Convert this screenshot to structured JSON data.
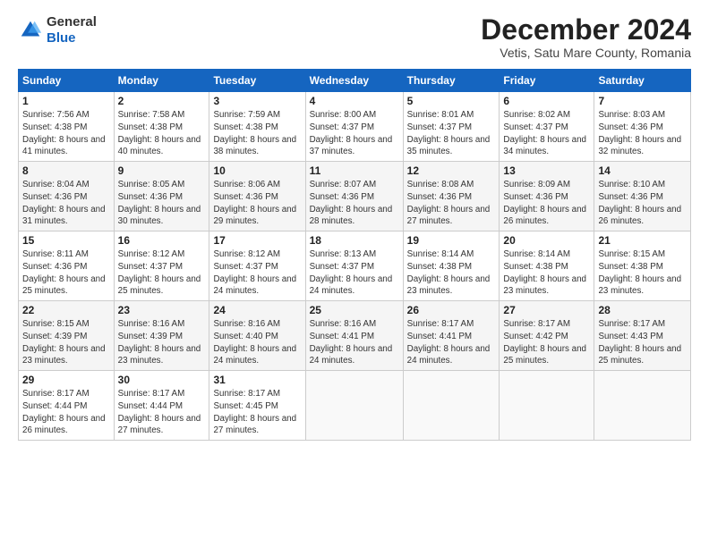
{
  "header": {
    "logo_general": "General",
    "logo_blue": "Blue",
    "month_title": "December 2024",
    "subtitle": "Vetis, Satu Mare County, Romania"
  },
  "days_of_week": [
    "Sunday",
    "Monday",
    "Tuesday",
    "Wednesday",
    "Thursday",
    "Friday",
    "Saturday"
  ],
  "weeks": [
    [
      {
        "num": "1",
        "sunrise": "7:56 AM",
        "sunset": "4:38 PM",
        "daylight": "8 hours and 41 minutes."
      },
      {
        "num": "2",
        "sunrise": "7:58 AM",
        "sunset": "4:38 PM",
        "daylight": "8 hours and 40 minutes."
      },
      {
        "num": "3",
        "sunrise": "7:59 AM",
        "sunset": "4:38 PM",
        "daylight": "8 hours and 38 minutes."
      },
      {
        "num": "4",
        "sunrise": "8:00 AM",
        "sunset": "4:37 PM",
        "daylight": "8 hours and 37 minutes."
      },
      {
        "num": "5",
        "sunrise": "8:01 AM",
        "sunset": "4:37 PM",
        "daylight": "8 hours and 35 minutes."
      },
      {
        "num": "6",
        "sunrise": "8:02 AM",
        "sunset": "4:37 PM",
        "daylight": "8 hours and 34 minutes."
      },
      {
        "num": "7",
        "sunrise": "8:03 AM",
        "sunset": "4:36 PM",
        "daylight": "8 hours and 32 minutes."
      }
    ],
    [
      {
        "num": "8",
        "sunrise": "8:04 AM",
        "sunset": "4:36 PM",
        "daylight": "8 hours and 31 minutes."
      },
      {
        "num": "9",
        "sunrise": "8:05 AM",
        "sunset": "4:36 PM",
        "daylight": "8 hours and 30 minutes."
      },
      {
        "num": "10",
        "sunrise": "8:06 AM",
        "sunset": "4:36 PM",
        "daylight": "8 hours and 29 minutes."
      },
      {
        "num": "11",
        "sunrise": "8:07 AM",
        "sunset": "4:36 PM",
        "daylight": "8 hours and 28 minutes."
      },
      {
        "num": "12",
        "sunrise": "8:08 AM",
        "sunset": "4:36 PM",
        "daylight": "8 hours and 27 minutes."
      },
      {
        "num": "13",
        "sunrise": "8:09 AM",
        "sunset": "4:36 PM",
        "daylight": "8 hours and 26 minutes."
      },
      {
        "num": "14",
        "sunrise": "8:10 AM",
        "sunset": "4:36 PM",
        "daylight": "8 hours and 26 minutes."
      }
    ],
    [
      {
        "num": "15",
        "sunrise": "8:11 AM",
        "sunset": "4:36 PM",
        "daylight": "8 hours and 25 minutes."
      },
      {
        "num": "16",
        "sunrise": "8:12 AM",
        "sunset": "4:37 PM",
        "daylight": "8 hours and 25 minutes."
      },
      {
        "num": "17",
        "sunrise": "8:12 AM",
        "sunset": "4:37 PM",
        "daylight": "8 hours and 24 minutes."
      },
      {
        "num": "18",
        "sunrise": "8:13 AM",
        "sunset": "4:37 PM",
        "daylight": "8 hours and 24 minutes."
      },
      {
        "num": "19",
        "sunrise": "8:14 AM",
        "sunset": "4:38 PM",
        "daylight": "8 hours and 23 minutes."
      },
      {
        "num": "20",
        "sunrise": "8:14 AM",
        "sunset": "4:38 PM",
        "daylight": "8 hours and 23 minutes."
      },
      {
        "num": "21",
        "sunrise": "8:15 AM",
        "sunset": "4:38 PM",
        "daylight": "8 hours and 23 minutes."
      }
    ],
    [
      {
        "num": "22",
        "sunrise": "8:15 AM",
        "sunset": "4:39 PM",
        "daylight": "8 hours and 23 minutes."
      },
      {
        "num": "23",
        "sunrise": "8:16 AM",
        "sunset": "4:39 PM",
        "daylight": "8 hours and 23 minutes."
      },
      {
        "num": "24",
        "sunrise": "8:16 AM",
        "sunset": "4:40 PM",
        "daylight": "8 hours and 24 minutes."
      },
      {
        "num": "25",
        "sunrise": "8:16 AM",
        "sunset": "4:41 PM",
        "daylight": "8 hours and 24 minutes."
      },
      {
        "num": "26",
        "sunrise": "8:17 AM",
        "sunset": "4:41 PM",
        "daylight": "8 hours and 24 minutes."
      },
      {
        "num": "27",
        "sunrise": "8:17 AM",
        "sunset": "4:42 PM",
        "daylight": "8 hours and 25 minutes."
      },
      {
        "num": "28",
        "sunrise": "8:17 AM",
        "sunset": "4:43 PM",
        "daylight": "8 hours and 25 minutes."
      }
    ],
    [
      {
        "num": "29",
        "sunrise": "8:17 AM",
        "sunset": "4:44 PM",
        "daylight": "8 hours and 26 minutes."
      },
      {
        "num": "30",
        "sunrise": "8:17 AM",
        "sunset": "4:44 PM",
        "daylight": "8 hours and 27 minutes."
      },
      {
        "num": "31",
        "sunrise": "8:17 AM",
        "sunset": "4:45 PM",
        "daylight": "8 hours and 27 minutes."
      },
      null,
      null,
      null,
      null
    ]
  ],
  "labels": {
    "sunrise": "Sunrise:",
    "sunset": "Sunset:",
    "daylight": "Daylight:"
  }
}
